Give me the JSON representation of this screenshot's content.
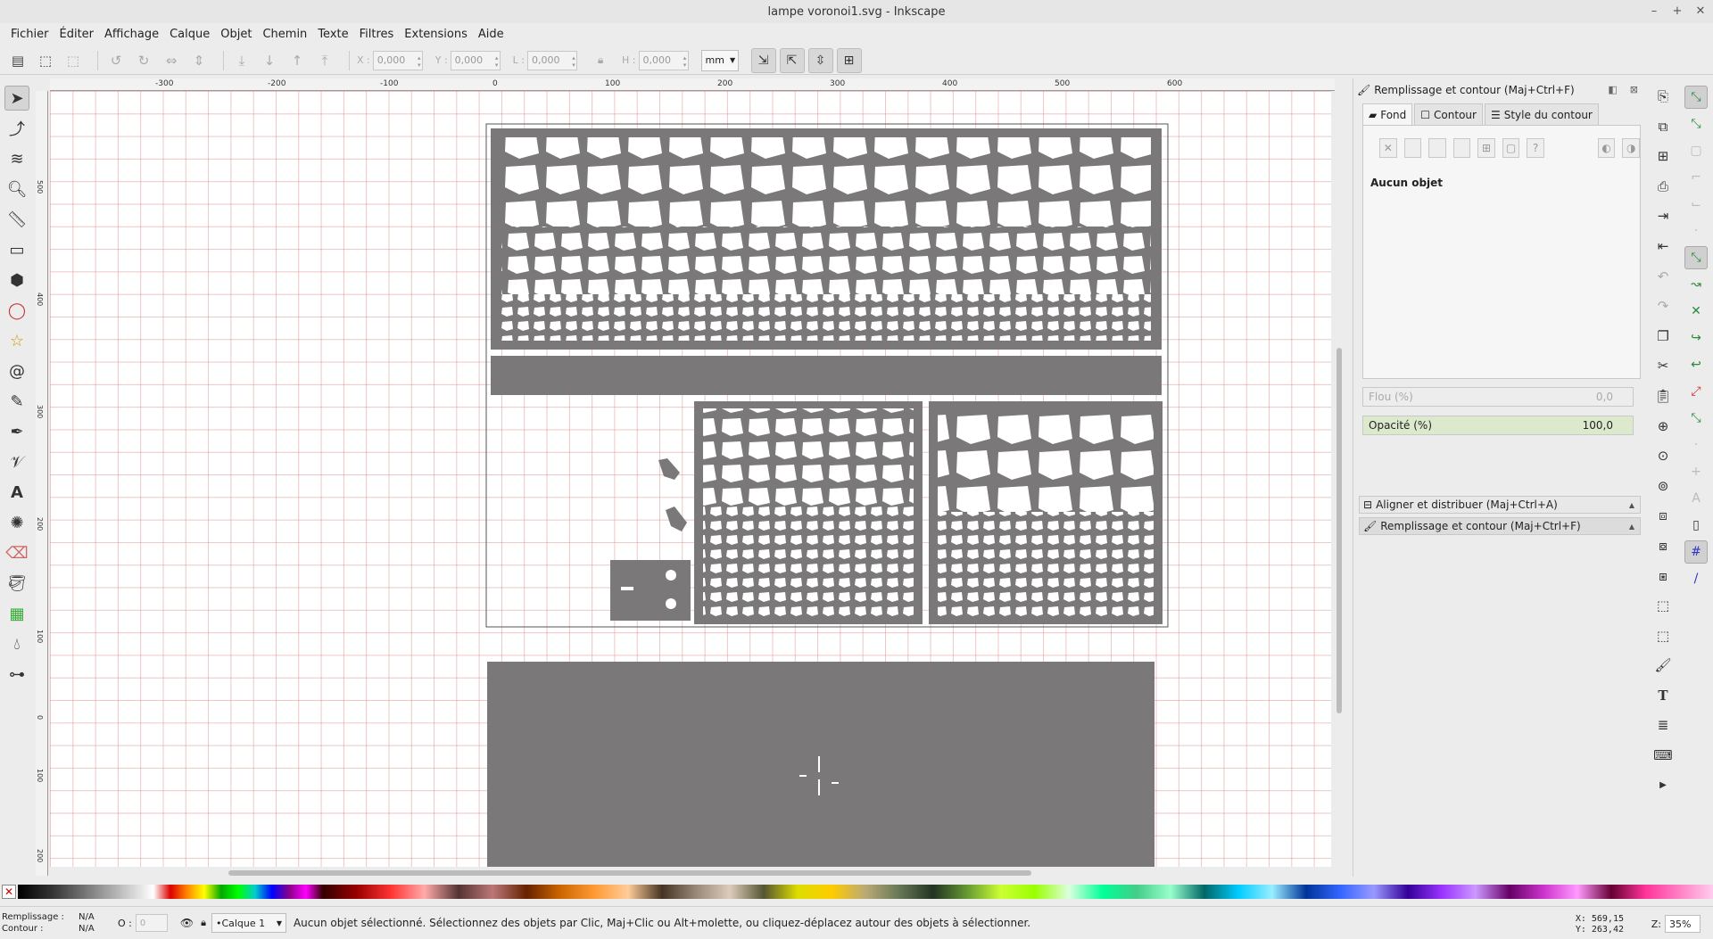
{
  "window": {
    "title": "lampe voronoi1.svg - Inkscape",
    "controls": [
      "–",
      "+",
      "✕"
    ]
  },
  "menu": [
    "Fichier",
    "Éditer",
    "Affichage",
    "Calque",
    "Objet",
    "Chemin",
    "Texte",
    "Filtres",
    "Extensions",
    "Aide"
  ],
  "toolbar": {
    "x_label": "X :",
    "x_value": "0,000",
    "y_label": "Y :",
    "y_value": "0,000",
    "w_label": "L :",
    "w_value": "0,000",
    "h_label": "H :",
    "h_value": "0,000",
    "unit": "mm"
  },
  "ruler_top": [
    "-300",
    "-200",
    "-100",
    "0",
    "100",
    "200",
    "300",
    "400",
    "500",
    "600"
  ],
  "ruler_left": [
    "500",
    "400",
    "300",
    "200",
    "100",
    "0",
    "100",
    "200"
  ],
  "dock": {
    "title": "Remplissage et contour (Maj+Ctrl+F)",
    "tabs": [
      "Fond",
      "Contour",
      "Style du contour"
    ],
    "no_object": "Aucun objet",
    "blur_label": "Flou (%)",
    "blur_value": "0,0",
    "opacity_label": "Opacité (%)",
    "opacity_value": "100,0",
    "panel_align": "Aligner et distribuer (Maj+Ctrl+A)",
    "panel_fill": "Remplissage et contour (Maj+Ctrl+F)"
  },
  "status": {
    "fill_label": "Remplissage :",
    "fill_value": "N/A",
    "stroke_label": "Contour :",
    "stroke_value": "N/A",
    "opacity_label": "O :",
    "opacity_value": "0",
    "layer": "•Calque 1",
    "message": "Aucun objet sélectionné. Sélectionnez des objets par Clic, Maj+Clic ou Alt+molette, ou cliquez-déplacez autour des objets à sélectionner.",
    "x_readout": "X:  569,15",
    "y_readout": "Y:  263,42",
    "zoom_label": "Z:",
    "zoom_value": "35%"
  },
  "colors": {
    "artwork": "#7a7878",
    "grid": "#e0a0a0",
    "page_border": "#555555"
  }
}
